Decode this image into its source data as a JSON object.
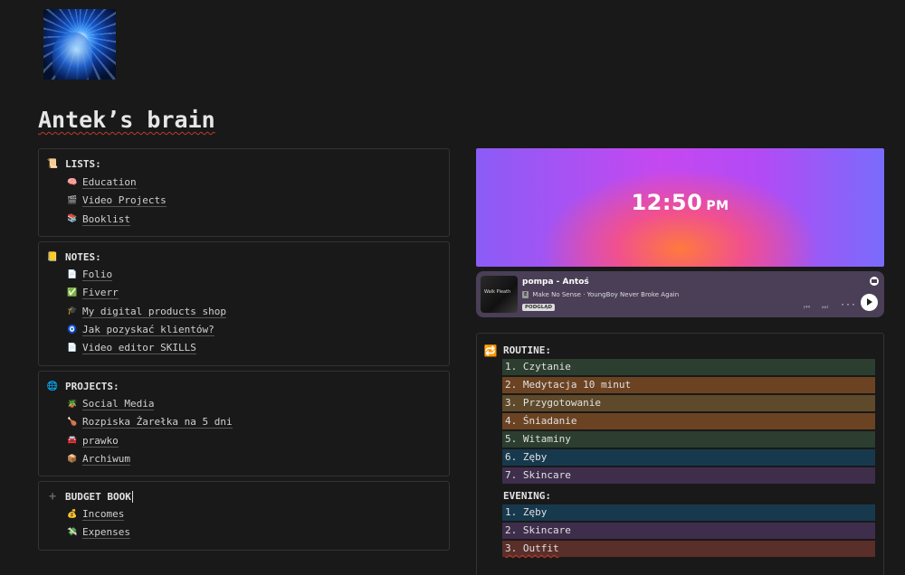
{
  "page": {
    "title": "Antek’s brain"
  },
  "lists": {
    "heading": "LISTS:",
    "items": [
      {
        "label": "Education",
        "icon": "🧠"
      },
      {
        "label": "Video Projects",
        "icon": "🎬"
      },
      {
        "label": "Booklist",
        "icon": "📚"
      }
    ]
  },
  "notes": {
    "heading": "NOTES:",
    "items": [
      {
        "label": "Folio",
        "icon": "📄"
      },
      {
        "label": "Fiverr",
        "icon": "✅"
      },
      {
        "label": "My digital products shop",
        "icon": "🎓"
      },
      {
        "label": "Jak pozyskać klientów?",
        "icon": "🧿"
      },
      {
        "label": "Video editor SKILLS",
        "icon": "📄"
      }
    ]
  },
  "projects": {
    "heading": "PROJECTS:",
    "items": [
      {
        "label": "Social Media",
        "icon": "🪴"
      },
      {
        "label": "Rozpiska Żarełka na 5 dni",
        "icon": "🍗"
      },
      {
        "label": "prawko",
        "icon": "🚘"
      },
      {
        "label": "Archiwum",
        "icon": "📦"
      }
    ]
  },
  "budget": {
    "heading": "BUDGET BOOK",
    "items": [
      {
        "label": "Incomes",
        "icon": "💰"
      },
      {
        "label": "Expenses",
        "icon": "💸"
      }
    ]
  },
  "clock": {
    "time": "12:50",
    "ampm": "PM"
  },
  "player": {
    "song": "pompa - Antoś",
    "explicit": "E",
    "next_track": "Make No Sense · YoungBoy Never Broke Again",
    "badge": "PODGLĄD",
    "art_text": "Walk Pleath"
  },
  "routine": {
    "heading": "ROUTINE:",
    "morning": [
      {
        "label": "1. Czytanie",
        "color": "#2c3e2f"
      },
      {
        "label": "2. Medytacja 10 minut",
        "color": "#6b4322"
      },
      {
        "label": "3. Przygotowanie",
        "color": "#5e4a2a"
      },
      {
        "label": "4. Śniadanie",
        "color": "#6b4322"
      },
      {
        "label": "5. Witaminy",
        "color": "#2c3e2f"
      },
      {
        "label": "6. Zęby",
        "color": "#17394d"
      },
      {
        "label": "7. Skincare",
        "color": "#3e2e4c"
      }
    ],
    "evening_heading": "EVENING:",
    "evening": [
      {
        "label": "1. Zęby",
        "color": "#17394d"
      },
      {
        "label": "2. Skincare",
        "color": "#3e2e4c"
      },
      {
        "label": "3. Outfit",
        "color": "#5a2e29"
      }
    ]
  }
}
